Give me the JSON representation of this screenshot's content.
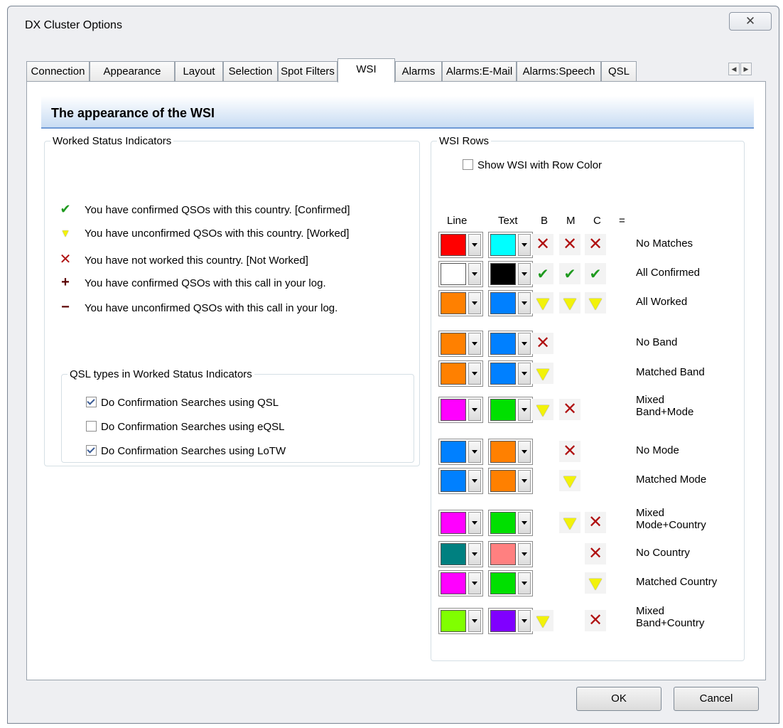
{
  "window": {
    "title": "DX Cluster Options",
    "close_glyph": "✕"
  },
  "tabs": [
    {
      "label": "Connection"
    },
    {
      "label": "Appearance"
    },
    {
      "label": "Layout"
    },
    {
      "label": "Selection"
    },
    {
      "label": "Spot Filters"
    },
    {
      "label": "WSI",
      "active": true
    },
    {
      "label": "Alarms"
    },
    {
      "label": "Alarms:E-Mail"
    },
    {
      "label": "Alarms:Speech"
    },
    {
      "label": "QSL"
    }
  ],
  "banner": {
    "title": "The appearance of the WSI"
  },
  "wsi_group": {
    "title": "Worked Status Indicators",
    "items": [
      {
        "icon": "confirmed-check-icon",
        "glyph": "✔",
        "text": "You have confirmed QSOs with this country. [Confirmed]"
      },
      {
        "icon": "worked-triangle-icon",
        "glyph": "▼",
        "text": "You have unconfirmed QSOs with this country. [Worked]"
      },
      {
        "icon": "not-worked-x-icon",
        "glyph": "✕",
        "text": "You have not worked this country. [Not Worked]"
      },
      {
        "icon": "plus-icon",
        "glyph": "+",
        "text": "You have confirmed QSOs with this call in your log."
      },
      {
        "icon": "minus-icon",
        "glyph": "−",
        "text": "You have unconfirmed QSOs with this call in your log."
      }
    ]
  },
  "qsl_group": {
    "title": "QSL types in Worked Status Indicators",
    "options": [
      {
        "label": "Do Confirmation Searches using QSL",
        "checked": true
      },
      {
        "label": "Do Confirmation Searches using eQSL",
        "checked": false
      },
      {
        "label": "Do Confirmation Searches using LoTW",
        "checked": true
      }
    ]
  },
  "rows_group": {
    "title": "WSI Rows",
    "show_row_color": {
      "label": "Show WSI with Row Color",
      "checked": false
    },
    "headers": {
      "line": "Line",
      "text": "Text",
      "b": "B",
      "m": "M",
      "c": "C",
      "eq": "="
    },
    "rows": [
      {
        "label": "No Matches",
        "line": "#ff0000",
        "text": "#00ffff",
        "b": "x",
        "m": "x",
        "c": "x"
      },
      {
        "label": "All Confirmed",
        "line": "#ffffff",
        "text": "#000000",
        "b": "check",
        "m": "check",
        "c": "check"
      },
      {
        "label": "All Worked",
        "line": "#ff8000",
        "text": "#0080ff",
        "b": "worked",
        "m": "worked",
        "c": "worked"
      },
      {
        "label": "No Band",
        "line": "#ff8000",
        "text": "#0080ff",
        "b": "x",
        "m": "",
        "c": ""
      },
      {
        "label": "Matched Band",
        "line": "#ff8000",
        "text": "#0080ff",
        "b": "worked",
        "m": "",
        "c": ""
      },
      {
        "label": "Mixed Band+Mode",
        "line": "#ff00ff",
        "text": "#00e000",
        "b": "worked",
        "m": "x",
        "c": ""
      },
      {
        "label": "No Mode",
        "line": "#0080ff",
        "text": "#ff8000",
        "b": "",
        "m": "x",
        "c": ""
      },
      {
        "label": "Matched Mode",
        "line": "#0080ff",
        "text": "#ff8000",
        "b": "",
        "m": "worked",
        "c": ""
      },
      {
        "label": "Mixed Mode+Country",
        "line": "#ff00ff",
        "text": "#00e000",
        "b": "",
        "m": "worked",
        "c": "x"
      },
      {
        "label": "No Country",
        "line": "#008080",
        "text": "#ff8080",
        "b": "",
        "m": "",
        "c": "x"
      },
      {
        "label": "Matched Country",
        "line": "#ff00ff",
        "text": "#00e000",
        "b": "",
        "m": "",
        "c": "worked"
      },
      {
        "label": "Mixed Band+Country",
        "line": "#80ff00",
        "text": "#8000ff",
        "b": "worked",
        "m": "",
        "c": "x"
      }
    ]
  },
  "buttons": {
    "ok": "OK",
    "cancel": "Cancel"
  }
}
